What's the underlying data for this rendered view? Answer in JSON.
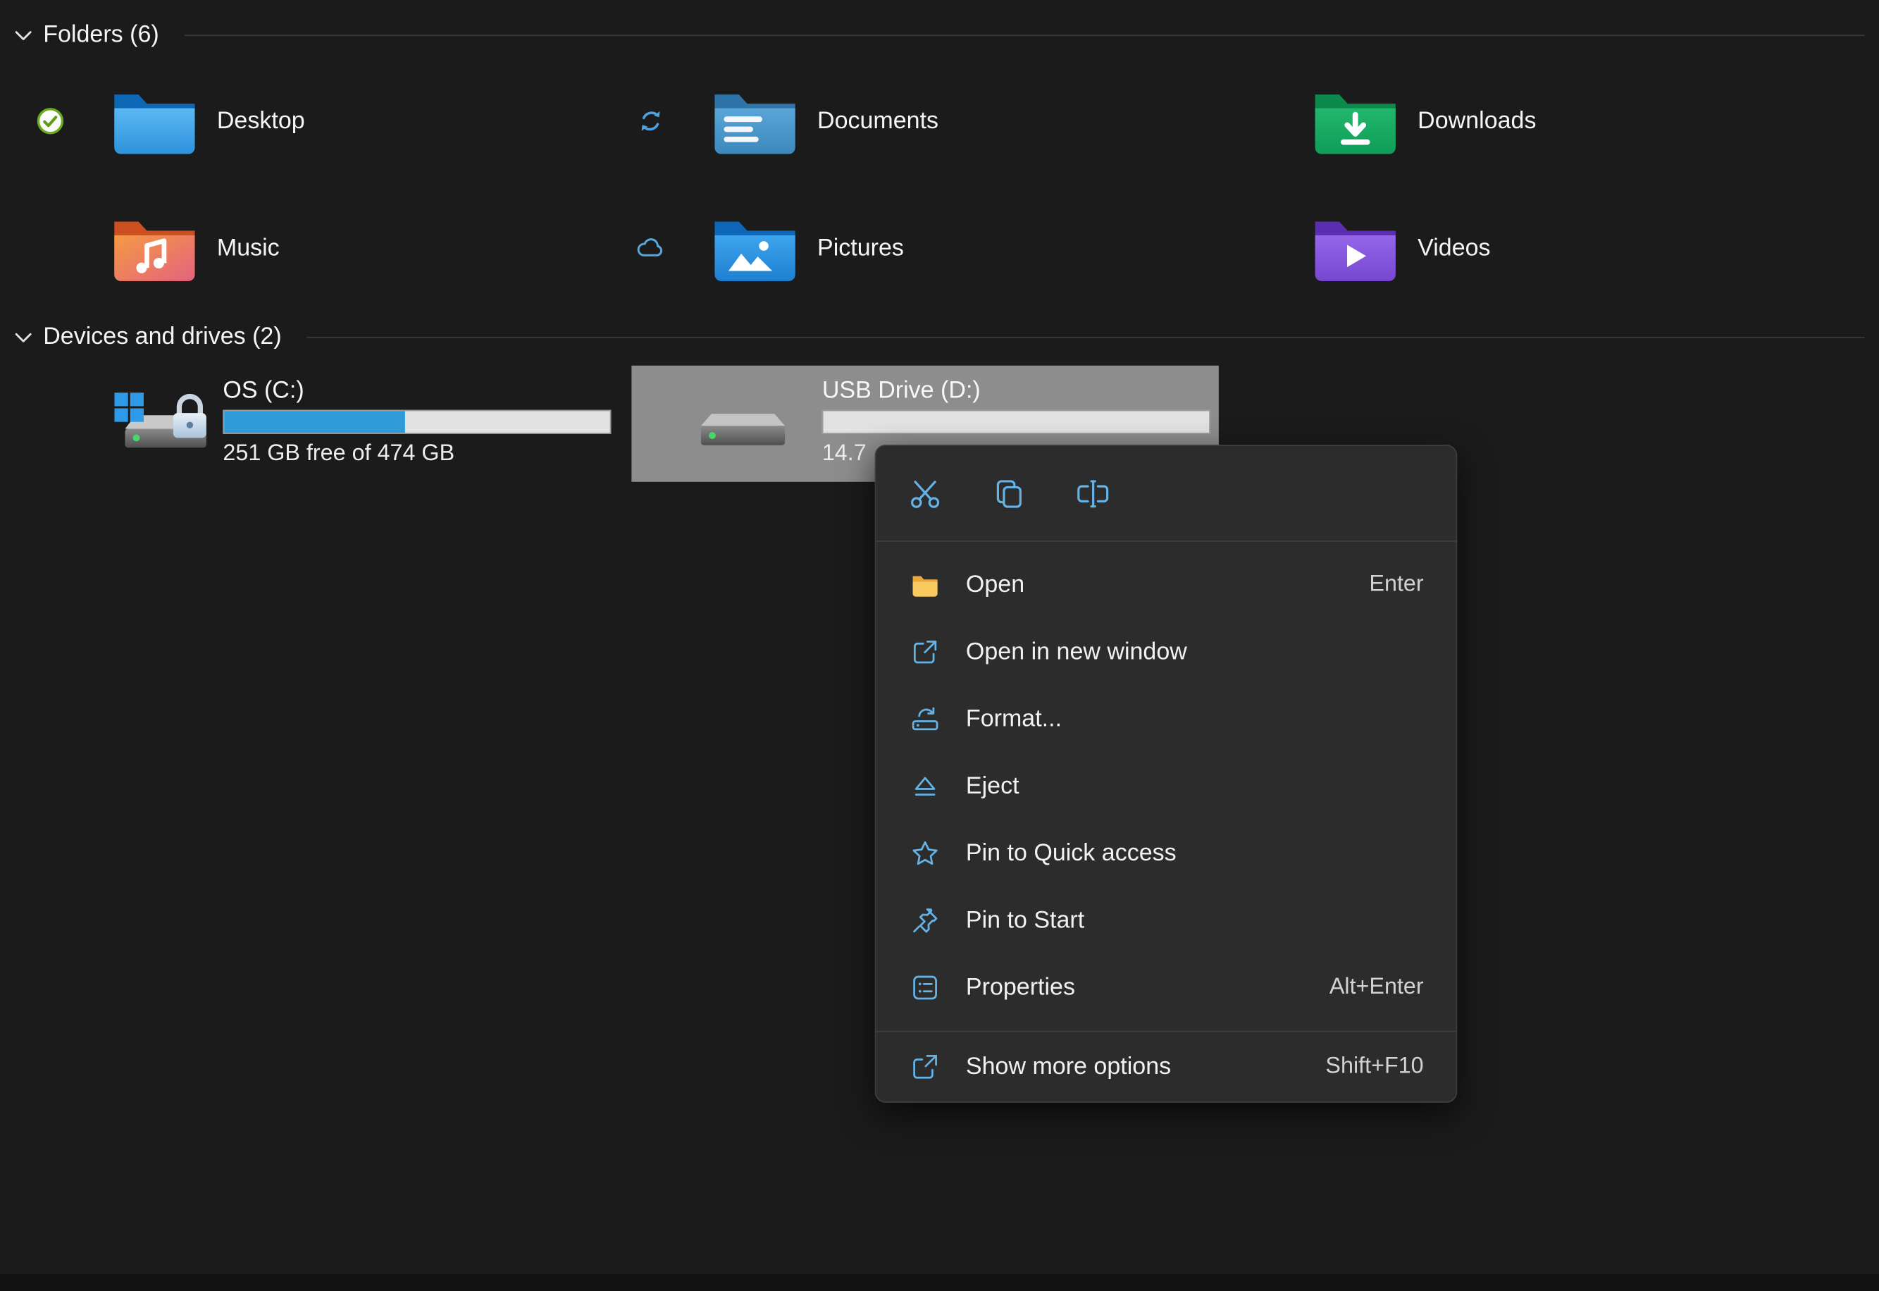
{
  "theme": {
    "background": "#1b1b1b",
    "selection_bg": "#8d8d8d",
    "progress_track": "#e2e2e2",
    "progress_fill": "#2e9bd8",
    "menu_bg": "#2c2c2c",
    "menu_icon_color": "#63b3e6",
    "sync_green": "#5e9c1a",
    "sync_blue": "#4aa3e0"
  },
  "sections": {
    "folders": {
      "label": "Folders (6)"
    },
    "devices": {
      "label": "Devices and drives (2)"
    }
  },
  "folders": [
    {
      "name": "Desktop",
      "status": "available-on-device"
    },
    {
      "name": "Documents",
      "status": "syncing"
    },
    {
      "name": "Downloads",
      "status": "none"
    },
    {
      "name": "Music",
      "status": "none"
    },
    {
      "name": "Pictures",
      "status": "cloud-only"
    },
    {
      "name": "Videos",
      "status": "none"
    }
  ],
  "drives": [
    {
      "name": "OS (C:)",
      "detail": "251 GB free of 474 GB",
      "used_percent": 47,
      "selected": false
    },
    {
      "name": "USB Drive (D:)",
      "detail": "14.7",
      "used_percent": 0,
      "selected": true
    }
  ],
  "context_menu": {
    "quick_actions": [
      {
        "name": "Cut"
      },
      {
        "name": "Copy"
      },
      {
        "name": "Rename"
      }
    ],
    "items": [
      {
        "label": "Open",
        "shortcut": "Enter"
      },
      {
        "label": "Open in new window",
        "shortcut": ""
      },
      {
        "label": "Format...",
        "shortcut": ""
      },
      {
        "label": "Eject",
        "shortcut": ""
      },
      {
        "label": "Pin to Quick access",
        "shortcut": ""
      },
      {
        "label": "Pin to Start",
        "shortcut": ""
      },
      {
        "label": "Properties",
        "shortcut": "Alt+Enter"
      }
    ],
    "more": {
      "label": "Show more options",
      "shortcut": "Shift+F10"
    }
  }
}
